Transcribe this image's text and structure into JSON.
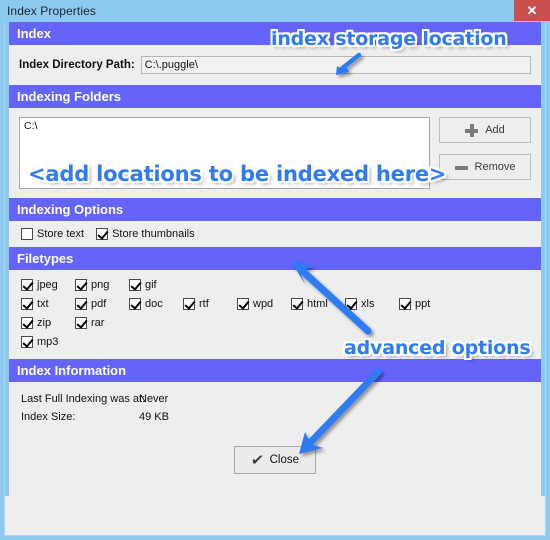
{
  "window": {
    "title": "Index Properties",
    "close_label": "✕"
  },
  "colors": {
    "section_header_bg": "#6464fa",
    "window_frame": "#8ecaf0",
    "client_bg": "#efeeee",
    "close_button_bg": "#c9504e",
    "annotation_text": "#2f7bf4",
    "arrow": "#2f7bf4"
  },
  "sections": {
    "index": {
      "header": "Index",
      "path_label": "Index Directory Path:",
      "path_value": "C:\\.puggle\\",
      "path_placeholder": "Index directory path"
    },
    "indexing_folders": {
      "header": "Indexing Folders",
      "folders": [
        "C:\\"
      ],
      "add_label": "Add",
      "remove_label": "Remove",
      "add_icon": "plus-icon",
      "remove_icon": "minus-icon"
    },
    "indexing_options": {
      "header": "Indexing Options",
      "options": [
        {
          "label": "Store text",
          "checked": false
        },
        {
          "label": "Store thumbnails",
          "checked": true
        }
      ]
    },
    "filetypes": {
      "header": "Filetypes",
      "rows": [
        [
          {
            "label": "jpeg",
            "checked": true
          },
          {
            "label": "png",
            "checked": true
          },
          {
            "label": "gif",
            "checked": true
          }
        ],
        [
          {
            "label": "txt",
            "checked": true
          },
          {
            "label": "pdf",
            "checked": true
          },
          {
            "label": "doc",
            "checked": true
          },
          {
            "label": "rtf",
            "checked": true
          },
          {
            "label": "wpd",
            "checked": true
          },
          {
            "label": "html",
            "checked": true
          },
          {
            "label": "xls",
            "checked": true
          },
          {
            "label": "ppt",
            "checked": true
          }
        ],
        [
          {
            "label": "zip",
            "checked": true
          },
          {
            "label": "rar",
            "checked": true
          }
        ],
        [
          {
            "label": "mp3",
            "checked": true
          }
        ]
      ]
    },
    "index_information": {
      "header": "Index Information",
      "rows": [
        {
          "key": "Last Full Indexing was at:",
          "value": "Never"
        },
        {
          "key": "Index Size:",
          "value": "49 KB"
        }
      ]
    }
  },
  "footer": {
    "close_label": "Close",
    "close_icon": "checkmark-icon",
    "check_glyph": "✔"
  },
  "annotations": [
    {
      "id": "storage",
      "text": "index storage location"
    },
    {
      "id": "folders",
      "text": "<add locations to be indexed here>"
    },
    {
      "id": "advanced",
      "text": "advanced options"
    }
  ]
}
